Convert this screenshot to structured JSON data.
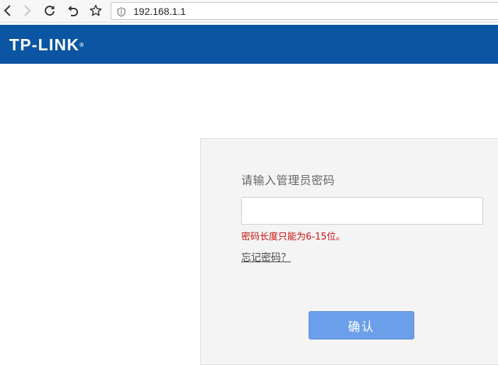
{
  "browser": {
    "url": "192.168.1.1",
    "icons": {
      "back": "chevron-left-icon",
      "forward": "chevron-right-icon",
      "reload": "reload-icon",
      "undo": "undo-icon",
      "bookmark": "star-icon",
      "security": "shield-icon"
    }
  },
  "header": {
    "logo_text": "TP-LINK",
    "logo_mark": "®",
    "bg_color": "#0b55a2"
  },
  "login": {
    "prompt": "请输入管理员密码",
    "password_value": "",
    "error": "密码长度只能为6-15位。",
    "forgot_link": "忘记密码？",
    "confirm_label": "确认",
    "button_color": "#6b9fea",
    "error_color": "#cc1111"
  }
}
